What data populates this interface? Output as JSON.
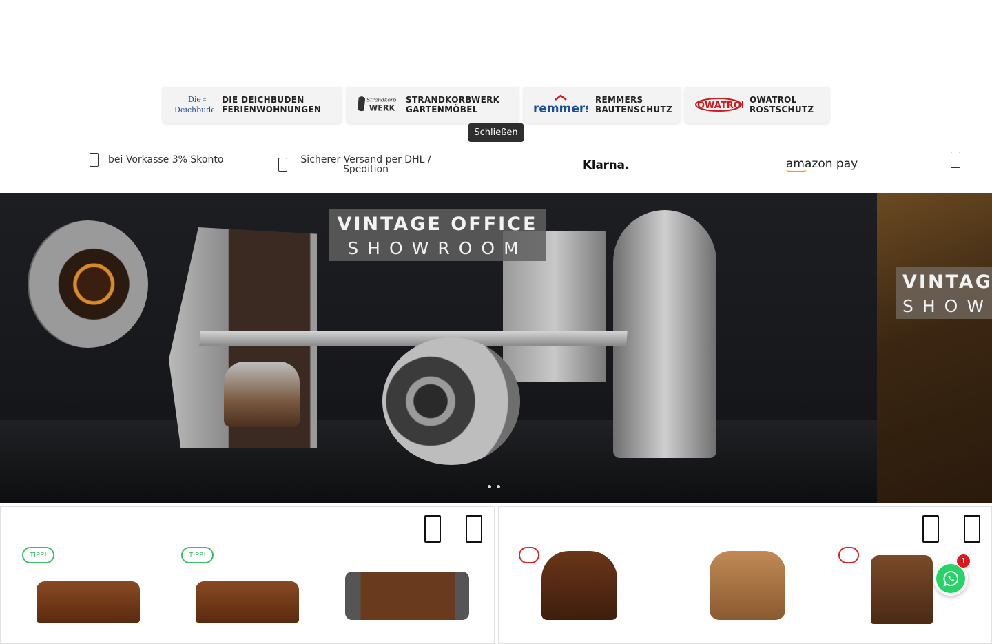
{
  "partners": [
    {
      "line1": "DIE DEICHBUDEN",
      "line2": "FERIENWOHNUNGEN",
      "logo_text1": "Die",
      "logo_text2": "Deichbuden",
      "logo_icon": "deichbuden-logo"
    },
    {
      "line1": "STRANDKORBWERK",
      "line2": "GARTENMÖBEL",
      "logo_text1": "Strandkorb",
      "logo_text2": "WERK",
      "logo_icon": "strandkorbwerk-logo"
    },
    {
      "line1": "REMMERS",
      "line2": "BAUTENSCHUTZ",
      "logo_text": "remmers",
      "logo_icon": "remmers-logo"
    },
    {
      "line1": "OWATROL",
      "line2": "ROSTSCHUTZ",
      "logo_text": "OWATROL",
      "logo_icon": "owatrol-logo"
    }
  ],
  "close_tooltip": "Schließen",
  "usp": {
    "item1": "bei Vorkasse 3% Skonto",
    "item2": "Sicherer Versand per DHL / Spedition",
    "klarna": "Klarna.",
    "amazon_pay": "amazon pay",
    "icon_phone": "phone-icon",
    "icon_truck": "truck-icon",
    "icon_next": "chevron-right-icon"
  },
  "hero": {
    "slide1_title1": "VINTAGE OFFICE",
    "slide1_title2": "SHOWROOM",
    "slide2_title1": "VINTAGE",
    "slide2_title2": "SHOW",
    "dots": 2
  },
  "carousels": {
    "left": {
      "badges": [
        "TIPP!",
        "TIPP!"
      ],
      "prev_icon": "chevron-left-icon",
      "next_icon": "chevron-right-icon"
    },
    "right": {
      "badge_icons": [
        "badge-icon",
        "badge-icon"
      ],
      "prev_icon": "chevron-left-icon",
      "next_icon": "chevron-right-icon"
    }
  },
  "whatsapp": {
    "count": "1",
    "icon": "whatsapp-icon"
  },
  "colors": {
    "accent_green": "#3cbf6a",
    "accent_red": "#dd2222",
    "whatsapp": "#25d366",
    "tooltip_bg": "#2e2e2e"
  }
}
